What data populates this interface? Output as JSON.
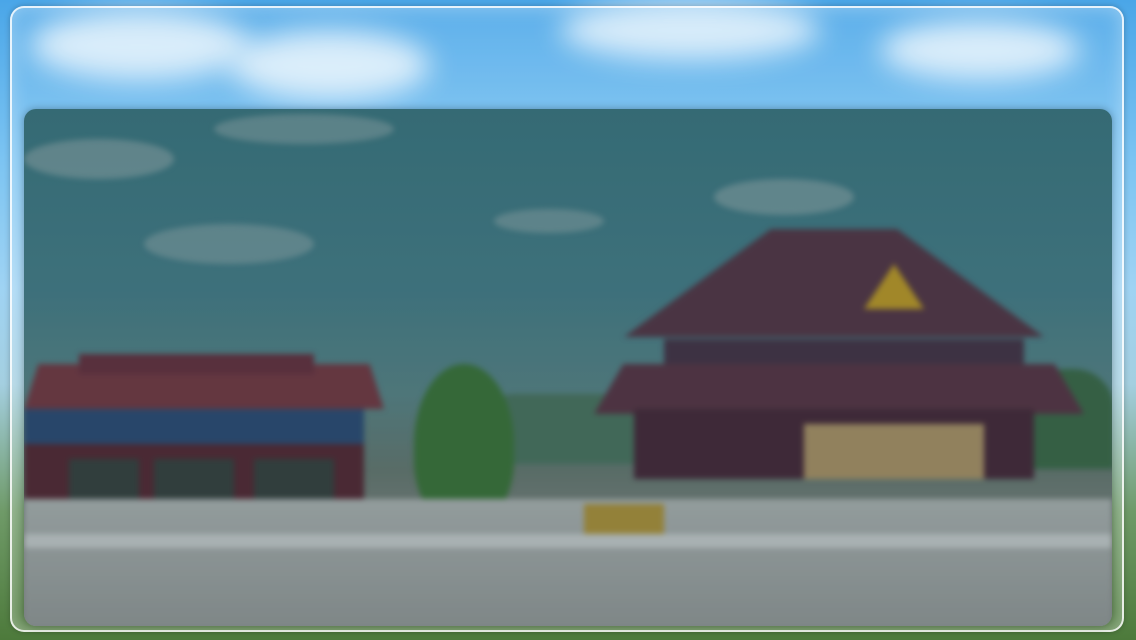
{
  "screen": {
    "description_colors": {
      "sky": "#7cc4f2",
      "panel_tint": "#3f7d87",
      "roof": "#6b2f3c",
      "gold": "#c9a227",
      "tree": "#3f7a3a",
      "wall": "#c9cfcf"
    }
  }
}
